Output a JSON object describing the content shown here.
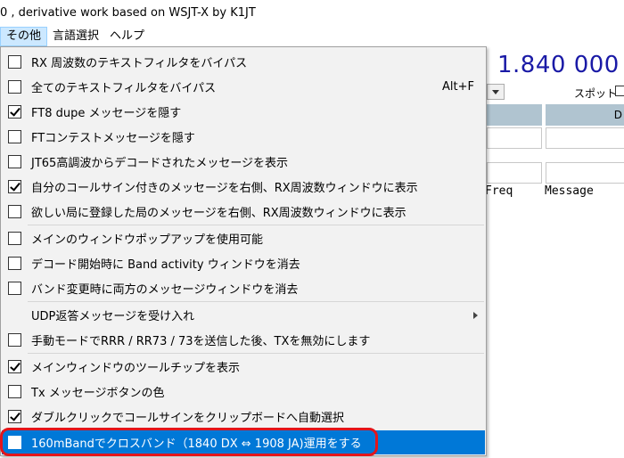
{
  "window": {
    "title": "0 , derivative work based on WSJT-X by K1JT"
  },
  "menubar": {
    "items": [
      "その他",
      "言語選択",
      "ヘルプ"
    ]
  },
  "main": {
    "frequency": "1.840 000",
    "spot_label": "スポット",
    "header_right": "D",
    "col_freq": "Freq",
    "col_message": "Message"
  },
  "menu": {
    "items": [
      {
        "label": "RX 周波数のテキストフィルタをバイパス",
        "checked": false
      },
      {
        "label": "全てのテキストフィルタをバイパス",
        "checked": false,
        "shortcut": "Alt+F"
      },
      {
        "label": "FT8 dupe メッセージを隠す",
        "checked": true
      },
      {
        "label": "FTコンテストメッセージを隠す",
        "checked": false
      },
      {
        "label": "JT65高調波からデコードされたメッセージを表示",
        "checked": false
      },
      {
        "label": "自分のコールサイン付きのメッセージを右側、RX周波数ウィンドウに表示",
        "checked": true
      },
      {
        "label": "欲しい局に登録した局のメッセージを右側、RX周波数ウィンドウに表示",
        "checked": false
      },
      {
        "label": "メインのウィンドウポップアップを使用可能",
        "checked": false
      },
      {
        "label": "デコード開始時に Band activity ウィンドウを消去",
        "checked": false
      },
      {
        "label": "バンド変更時に両方のメッセージウィンドウを消去",
        "checked": false
      },
      {
        "label": "UDP返答メッセージを受け入れ",
        "submenu": true
      },
      {
        "label": "手動モードでRRR / RR73 / 73を送信した後、TXを無効にします",
        "checked": false
      },
      {
        "label": "メインウィンドウのツールチップを表示",
        "checked": true
      },
      {
        "label": "Tx メッセージボタンの色",
        "checked": false
      },
      {
        "label": "ダブルクリックでコールサインをクリップボードへ自動選択",
        "checked": true
      },
      {
        "label": "160mBandでクロスバンド（1840 DX ⇔ 1908 JA)運用をする",
        "checked": false,
        "highlighted": true
      }
    ]
  },
  "colors": {
    "highlight": "#0078d7",
    "frequency": "#1a1aa6",
    "callout": "#e3151a"
  }
}
